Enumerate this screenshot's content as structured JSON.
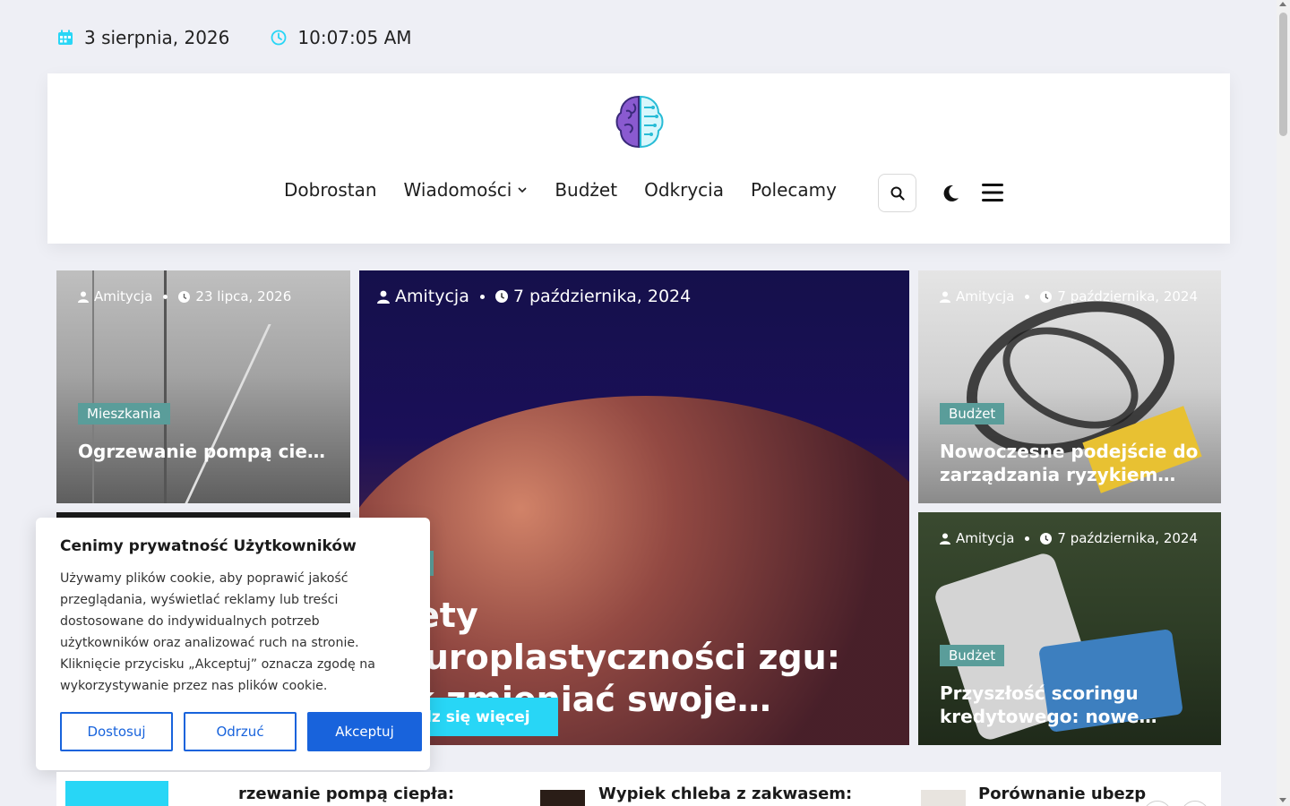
{
  "topbar": {
    "date": "3 sierpnia, 2026",
    "time": "10:07:05 AM",
    "accent_color": "#28d6f6"
  },
  "nav": {
    "items": [
      "Dobrostan",
      "Wiadomości",
      "Budżet",
      "Odkrycia",
      "Polecamy"
    ]
  },
  "cards": [
    {
      "author": "Amitycja",
      "date": "23 lipca, 2026",
      "category": "Mieszkania",
      "title": "Ogrzewanie pompą ciepła: ekonomiczne i ekologiczn…"
    },
    {
      "author": "Amitycja",
      "date": "7 października, 2024",
      "category": "ycia",
      "title": "krety neuroplastyczności zgu: jak zmieniać swoje…",
      "button": "iedz się więcej"
    },
    {
      "author": "Amitycja",
      "date": "7 października, 2024",
      "category": "Budżet",
      "title": "Nowoczesne podejście do zarządzania ryzykiem…"
    },
    {
      "author": "Amitycja",
      "date": "7 października, 2024",
      "category": "Budżet",
      "title": "Przyszłość scoringu kredytowego: nowe…"
    }
  ],
  "cookie": {
    "title": "Cenimy prywatność Użytkowników",
    "text": "Używamy plików cookie, aby poprawić jakość przeglądania, wyświetlać reklamy lub treści dostosowane do indywidualnych potrzeb użytkowników oraz analizować ruch na stronie. Kliknięcie przycisku „Akceptuj” oznacza zgodę na wykorzystywanie przez nas plików cookie.",
    "customize": "Dostosuj",
    "reject": "Odrzuć",
    "accept": "Akceptuj",
    "accent_color": "#1863dc"
  },
  "ticker": {
    "items": [
      "rzewanie pompą ciepła:",
      "Wypiek chleba z zakwasem:",
      "Porównanie ubezp"
    ]
  }
}
